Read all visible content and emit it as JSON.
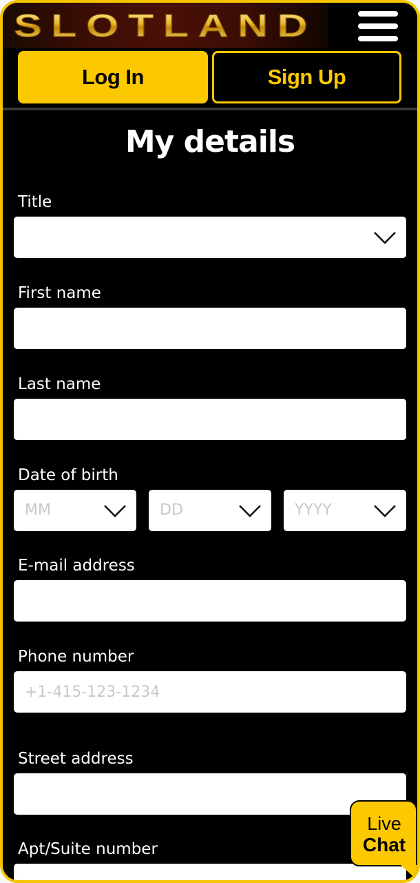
{
  "header": {
    "logo_text": "SLOTLAND",
    "menu_icon": "hamburger-menu-icon"
  },
  "auth": {
    "login_label": "Log In",
    "signup_label": "Sign Up"
  },
  "form": {
    "title": "My details",
    "fields": {
      "title": {
        "label": "Title",
        "value": ""
      },
      "first_name": {
        "label": "First name",
        "value": "",
        "placeholder": ""
      },
      "last_name": {
        "label": "Last name",
        "value": "",
        "placeholder": ""
      },
      "dob": {
        "label": "Date of birth",
        "month_placeholder": "MM",
        "day_placeholder": "DD",
        "year_placeholder": "YYYY"
      },
      "email": {
        "label": "E-mail address",
        "value": "",
        "placeholder": ""
      },
      "phone": {
        "label": "Phone number",
        "value": "",
        "placeholder": "+1-415-123-1234"
      },
      "street": {
        "label": "Street address",
        "value": "",
        "placeholder": ""
      },
      "apt": {
        "label": "Apt/Suite number",
        "value": "",
        "placeholder": ""
      }
    }
  },
  "live_chat": {
    "line1": "Live",
    "line2": "Chat"
  },
  "colors": {
    "accent": "#fcc800",
    "background": "#000000",
    "frame": "#f4c400",
    "input_bg": "#ffffff",
    "placeholder": "#c8c8c8"
  }
}
